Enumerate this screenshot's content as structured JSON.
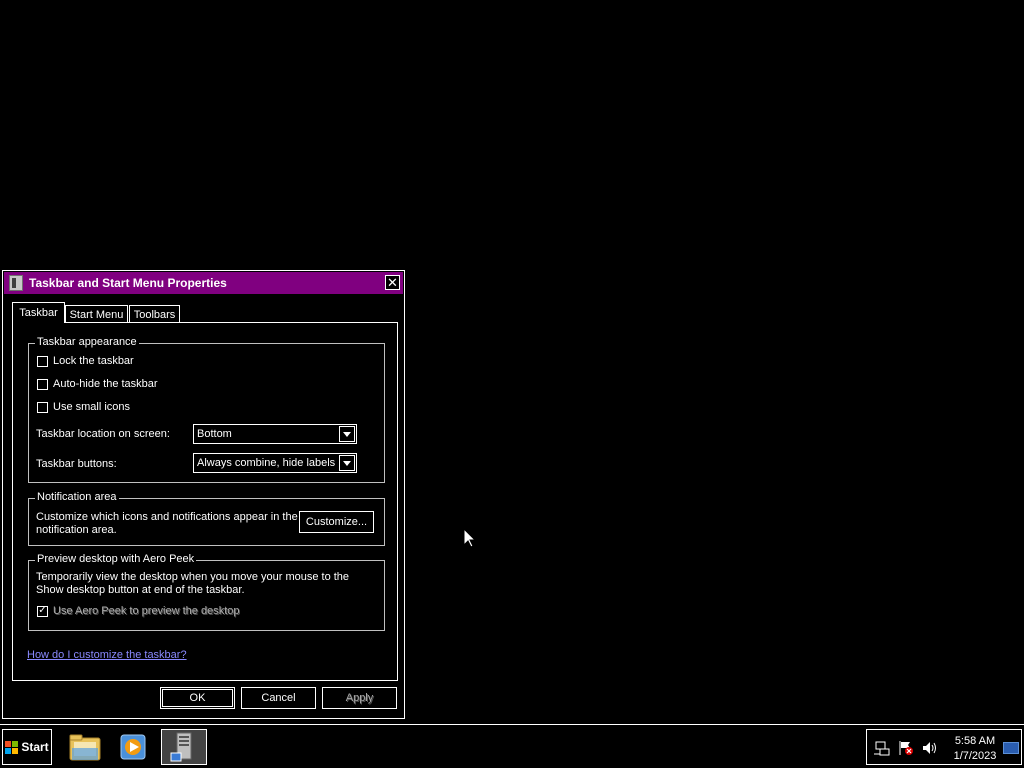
{
  "dialog": {
    "title": "Taskbar and Start Menu Properties",
    "tabs": [
      {
        "label": "Taskbar",
        "active": true
      },
      {
        "label": "Start Menu",
        "active": false
      },
      {
        "label": "Toolbars",
        "active": false
      }
    ],
    "appearance": {
      "title": "Taskbar appearance",
      "lock_label": "Lock the taskbar",
      "lock_checked": false,
      "autohide_label": "Auto-hide the taskbar",
      "autohide_checked": false,
      "small_icons_label": "Use small icons",
      "small_icons_checked": false,
      "location_label": "Taskbar location on screen:",
      "location_value": "Bottom",
      "buttons_label": "Taskbar buttons:",
      "buttons_value": "Always combine, hide labels"
    },
    "notification": {
      "title": "Notification area",
      "description": "Customize which icons and notifications appear in the notification area.",
      "customize_label": "Customize..."
    },
    "aero": {
      "title": "Preview desktop with Aero Peek",
      "description": "Temporarily view the desktop when you move your mouse to the Show desktop button at end of the taskbar.",
      "peek_label": "Use Aero Peek to preview the desktop",
      "peek_checked": true
    },
    "help_link": "How do I customize the taskbar?",
    "ok_label": "OK",
    "cancel_label": "Cancel",
    "apply_label": "Apply"
  },
  "taskbar": {
    "start_label": "Start",
    "items": [
      "windows-explorer-icon",
      "media-player-icon",
      "server-manager-icon"
    ],
    "clock_time": "5:58 AM",
    "clock_date": "1/7/2023"
  },
  "colors": {
    "titlebar": "#800080",
    "link": "#8a8aff",
    "background": "#000000"
  }
}
